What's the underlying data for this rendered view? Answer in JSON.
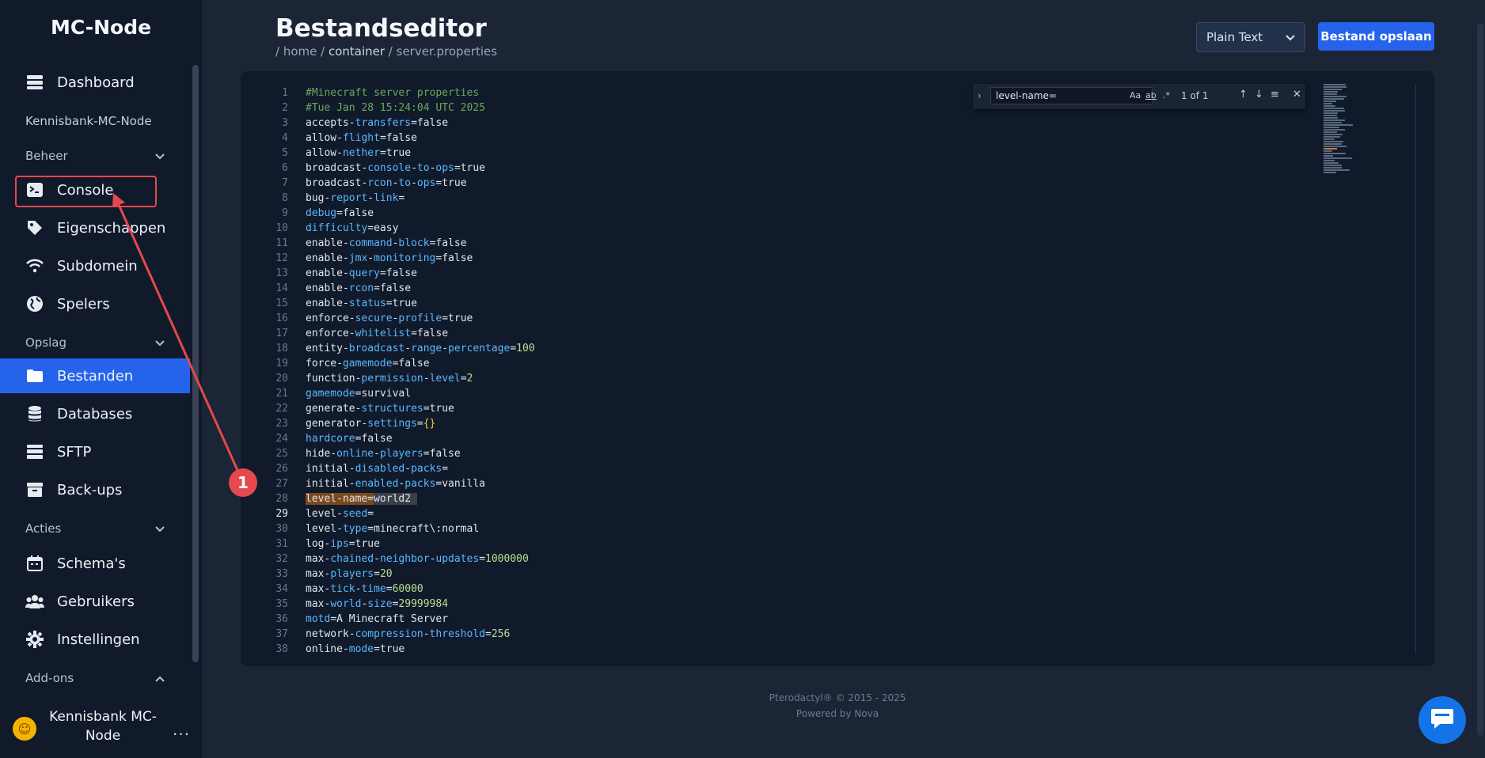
{
  "sidebar": {
    "brand": "MC-Node",
    "dashboard": "Dashboard",
    "server_name": "Kennisbank-MC-Node",
    "sections": {
      "beheer": "Beheer",
      "opslag": "Opslag",
      "acties": "Acties",
      "addons": "Add-ons"
    },
    "items": {
      "console": "Console",
      "eigenschappen": "Eigenschappen",
      "subdomein": "Subdomein",
      "spelers": "Spelers",
      "bestanden": "Bestanden",
      "databases": "Databases",
      "sftp": "SFTP",
      "backups": "Back-ups",
      "schemas": "Schema's",
      "gebruikers": "Gebruikers",
      "instellingen": "Instellingen"
    },
    "active_item": "Bestanden",
    "user": {
      "name": "Kennisbank MC-Node",
      "more": "..."
    }
  },
  "header": {
    "title": "Bestandseditor",
    "breadcrumb": {
      "sep1": "/ ",
      "home": "home",
      "sep2": " / ",
      "container": "container",
      "sep3": " / ",
      "file": "server.properties"
    },
    "language_select": "Plain Text",
    "save_button": "Bestand opslaan"
  },
  "editor": {
    "current_line": 29,
    "highlighted_line": 28,
    "lines": [
      {
        "n": "1",
        "t": "#Minecraft server properties"
      },
      {
        "n": "2",
        "t": "#Tue Jan 28 15:24:04 UTC 2025"
      },
      {
        "n": "3",
        "t": "accepts-transfers=false"
      },
      {
        "n": "4",
        "t": "allow-flight=false"
      },
      {
        "n": "5",
        "t": "allow-nether=true"
      },
      {
        "n": "6",
        "t": "broadcast-console-to-ops=true"
      },
      {
        "n": "7",
        "t": "broadcast-rcon-to-ops=true"
      },
      {
        "n": "8",
        "t": "bug-report-link="
      },
      {
        "n": "9",
        "t": "debug=false"
      },
      {
        "n": "10",
        "t": "difficulty=easy"
      },
      {
        "n": "11",
        "t": "enable-command-block=false"
      },
      {
        "n": "12",
        "t": "enable-jmx-monitoring=false"
      },
      {
        "n": "13",
        "t": "enable-query=false"
      },
      {
        "n": "14",
        "t": "enable-rcon=false"
      },
      {
        "n": "15",
        "t": "enable-status=true"
      },
      {
        "n": "16",
        "t": "enforce-secure-profile=true"
      },
      {
        "n": "17",
        "t": "enforce-whitelist=false"
      },
      {
        "n": "18",
        "t": "entity-broadcast-range-percentage=100"
      },
      {
        "n": "19",
        "t": "force-gamemode=false"
      },
      {
        "n": "20",
        "t": "function-permission-level=2"
      },
      {
        "n": "21",
        "t": "gamemode=survival"
      },
      {
        "n": "22",
        "t": "generate-structures=true"
      },
      {
        "n": "23",
        "t": "generator-settings={}"
      },
      {
        "n": "24",
        "t": "hardcore=false"
      },
      {
        "n": "25",
        "t": "hide-online-players=false"
      },
      {
        "n": "26",
        "t": "initial-disabled-packs="
      },
      {
        "n": "27",
        "t": "initial-enabled-packs=vanilla"
      },
      {
        "n": "28",
        "t": "level-name=world2"
      },
      {
        "n": "29",
        "t": "level-seed="
      },
      {
        "n": "30",
        "t": "level-type=minecraft\\:normal"
      },
      {
        "n": "31",
        "t": "log-ips=true"
      },
      {
        "n": "32",
        "t": "max-chained-neighbor-updates=1000000"
      },
      {
        "n": "33",
        "t": "max-players=20"
      },
      {
        "n": "34",
        "t": "max-tick-time=60000"
      },
      {
        "n": "35",
        "t": "max-world-size=29999984"
      },
      {
        "n": "36",
        "t": "motd=A Minecraft Server"
      },
      {
        "n": "37",
        "t": "network-compression-threshold=256"
      },
      {
        "n": "38",
        "t": "online-mode=true"
      }
    ],
    "find": {
      "query": "level-name=",
      "match_case": "Aa",
      "whole_word": "ab",
      "regex": ".*",
      "count": "1 of 1"
    }
  },
  "footer": {
    "copyright": "Pterodactyl® © 2015 - 2025",
    "powered": "Powered by Nova"
  },
  "annotation": {
    "marker": "1",
    "color": "#e5484d"
  },
  "colors": {
    "accent": "#2563eb",
    "sidebar_bg": "#111a2b",
    "page_bg": "#1b2536"
  }
}
